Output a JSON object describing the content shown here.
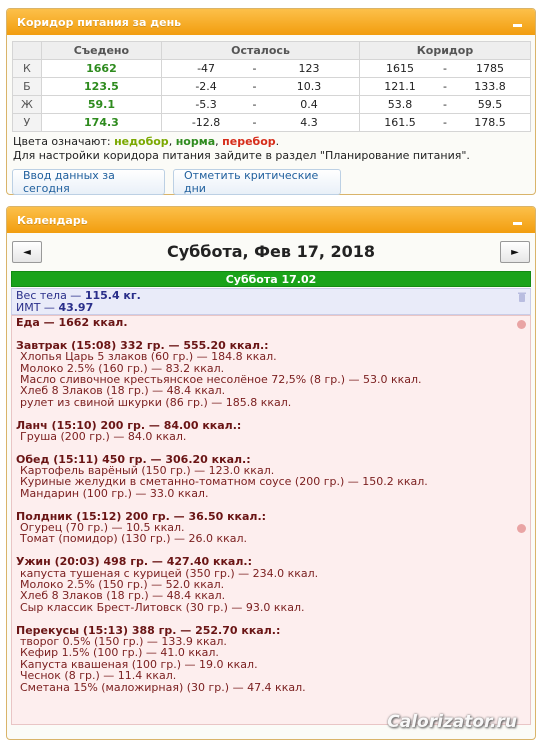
{
  "corridor_panel": {
    "title": "Коридор питания за день",
    "headers": {
      "label": "",
      "eaten": "Съедено",
      "left": "Осталось",
      "corridor": "Коридор"
    },
    "rows": [
      {
        "label": "К",
        "eaten": "1662",
        "left_from": "-47",
        "left_to": "123",
        "corr_from": "1615",
        "corr_to": "1785"
      },
      {
        "label": "Б",
        "eaten": "123.5",
        "left_from": "-2.4",
        "left_to": "10.3",
        "corr_from": "121.1",
        "corr_to": "133.8"
      },
      {
        "label": "Ж",
        "eaten": "59.1",
        "left_from": "-5.3",
        "left_to": "0.4",
        "corr_from": "53.8",
        "corr_to": "59.5"
      },
      {
        "label": "У",
        "eaten": "174.3",
        "left_from": "-12.8",
        "left_to": "4.3",
        "corr_from": "161.5",
        "corr_to": "178.5"
      }
    ],
    "dash": "-",
    "legend_prefix": "Цвета означают: ",
    "legend_under": "недобор",
    "legend_sep1": ", ",
    "legend_norm": "норма",
    "legend_sep2": ", ",
    "legend_over": "перебор",
    "legend_end": ".",
    "settings_note": "Для настройки коридора питания зайдите в раздел \"Планирование питания\".",
    "btn_today": "Ввод данных за сегодня",
    "btn_critical": "Отметить критические дни"
  },
  "calendar_panel": {
    "title": "Календарь",
    "prev": "◄",
    "next": "►",
    "date_title": "Суббота, Фев 17, 2018",
    "day_bar": "Суббота 17.02",
    "weight_label": "Вес тела — ",
    "weight_value": "115.4 кг.",
    "bmi_label": "ИМТ — ",
    "bmi_value": "43.97",
    "food_lines": [
      {
        "type": "meal",
        "text": "Еда — 1662 ккал."
      },
      {
        "type": "gap",
        "text": ""
      },
      {
        "type": "meal",
        "text": "Завтрак (15:08) 332 гр. — 555.20 ккал.:"
      },
      {
        "type": "item",
        "text": "Хлопья Царь 5 злаков (60 гр.) — 184.8 ккал."
      },
      {
        "type": "item",
        "text": "Молоко 2.5% (160 гр.) — 83.2 ккал."
      },
      {
        "type": "item",
        "text": "Масло сливочное крестьянское несолёное 72,5% (8 гр.) — 53.0 ккал."
      },
      {
        "type": "item",
        "text": "Хлеб 8 Злаков (18 гр.) — 48.4 ккал."
      },
      {
        "type": "item",
        "text": "рулет из свиной шкурки (86 гр.) — 185.8 ккал."
      },
      {
        "type": "gap",
        "text": ""
      },
      {
        "type": "meal",
        "text": "Ланч (15:10) 200 гр. — 84.00 ккал.:"
      },
      {
        "type": "item",
        "text": "Груша (200 гр.) — 84.0 ккал."
      },
      {
        "type": "gap",
        "text": ""
      },
      {
        "type": "meal",
        "text": "Обед (15:11) 450 гр. — 306.20 ккал.:"
      },
      {
        "type": "item",
        "text": "Картофель варёный (150 гр.) — 123.0 ккал."
      },
      {
        "type": "item",
        "text": "Куриные желудки в сметанно-томатном соусе (200 гр.) — 150.2 ккал."
      },
      {
        "type": "item",
        "text": "Мандарин (100 гр.) — 33.0 ккал."
      },
      {
        "type": "gap",
        "text": ""
      },
      {
        "type": "meal",
        "text": "Полдник (15:12) 200 гр. — 36.50 ккал.:"
      },
      {
        "type": "item",
        "text": "Огурец (70 гр.) — 10.5 ккал."
      },
      {
        "type": "item",
        "text": "Томат (помидор) (130 гр.) — 26.0 ккал."
      },
      {
        "type": "gap",
        "text": ""
      },
      {
        "type": "meal",
        "text": "Ужин (20:03) 498 гр. — 427.40 ккал.:"
      },
      {
        "type": "item",
        "text": "капуста тушеная с курицей (350 гр.) — 234.0 ккал."
      },
      {
        "type": "item",
        "text": "Молоко 2.5% (150 гр.) — 52.0 ккал."
      },
      {
        "type": "item",
        "text": "Хлеб 8 Злаков (18 гр.) — 48.4 ккал."
      },
      {
        "type": "item",
        "text": "Сыр классик Брест-Литовск (30 гр.) — 93.0 ккал."
      },
      {
        "type": "gap",
        "text": ""
      },
      {
        "type": "meal",
        "text": "Перекусы (15:13) 388 гр. — 252.70 ккал.:"
      },
      {
        "type": "item",
        "text": "творог 0.5% (150 гр.) — 133.9 ккал."
      },
      {
        "type": "item",
        "text": "Кефир 1.5% (100 гр.) — 41.0 ккал."
      },
      {
        "type": "item",
        "text": "Капуста квашеная (100 гр.) — 19.0 ккал."
      },
      {
        "type": "item",
        "text": "Чеснок (8 гр.) — 11.4 ккал."
      },
      {
        "type": "item",
        "text": "Сметана 15% (маложирная) (30 гр.) — 47.4 ккал."
      }
    ]
  },
  "watermark": "Calorizator.ru",
  "colors": {
    "header_orange": "#f29d0e",
    "under": "#7aa800",
    "norm": "#2e8b1e",
    "over": "#d62c1a",
    "day_bar": "#1aa31a"
  }
}
